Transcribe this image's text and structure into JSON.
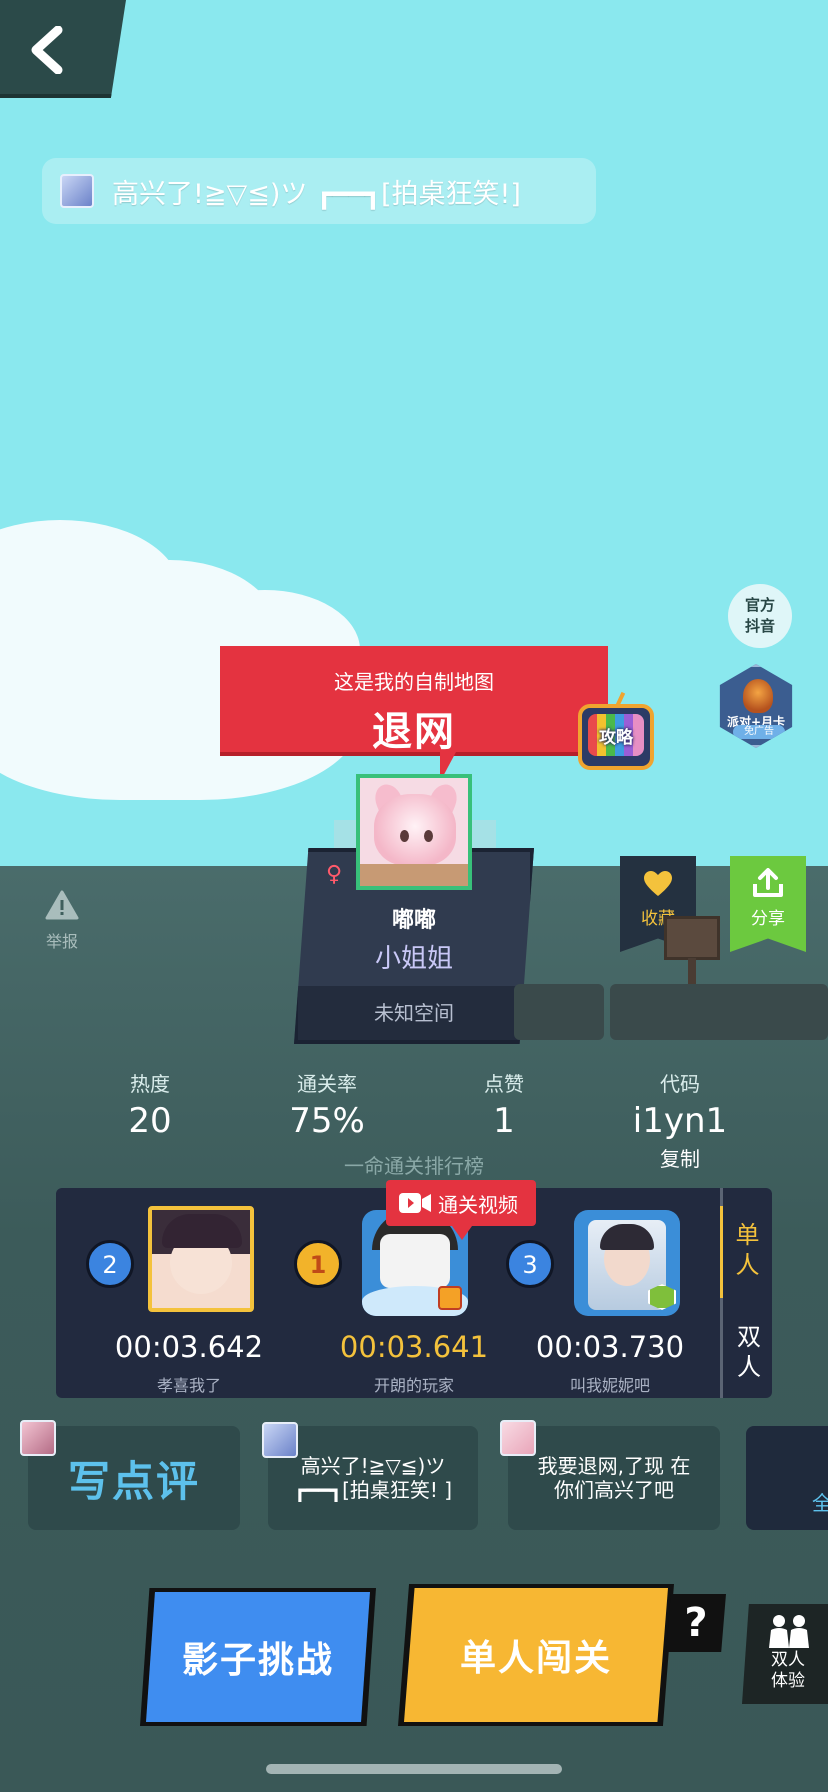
{
  "banner": {
    "text": "高兴了!≧▽≦)ツ ┏━━┓[拍桌狂笑!]"
  },
  "top_right": {
    "official_label": "官方\n抖音",
    "promo_label": "派对+月卡",
    "promo_sub": "免广告"
  },
  "map": {
    "subtitle": "这是我的自制地图",
    "title": "退网",
    "guide_label": "攻略"
  },
  "creator": {
    "gender": "♀",
    "name": "嘟嘟",
    "title": "小姐姐",
    "space": "未知空间"
  },
  "actions": {
    "report_label": "举报",
    "favorite_label": "收藏",
    "share_label": "分享"
  },
  "stats": {
    "heat": {
      "label": "热度",
      "value": "20"
    },
    "clear_rate": {
      "label": "通关率",
      "value": "75%"
    },
    "likes": {
      "label": "点赞",
      "value": "1"
    },
    "code": {
      "label": "代码",
      "value": "i1yn1",
      "copy_label": "复制"
    }
  },
  "leaderboard": {
    "title": "一命通关排行榜",
    "video_label": "通关视频",
    "tabs": [
      "单人",
      "双人"
    ],
    "entries": [
      {
        "rank": "2",
        "time": "00:03.642",
        "name": "孝喜我了"
      },
      {
        "rank": "1",
        "time": "00:03.641",
        "name": "开朗的玩家"
      },
      {
        "rank": "3",
        "time": "00:03.730",
        "name": "叫我妮妮吧"
      }
    ]
  },
  "comments": {
    "write_label": "写点评",
    "items": [
      {
        "text": "高兴了!≧▽≦)ツ ┏━━┓[拍桌狂笑! ]"
      },
      {
        "text": "我要退网,了现 在你们高兴了吧"
      }
    ],
    "more_partial": "全"
  },
  "buttons": {
    "shadow_challenge": "影子挑战",
    "single_play": "单人闯关",
    "help": "?",
    "duo_label": "双人\n体验"
  },
  "colors": {
    "sky": "#8ae8ee",
    "ground": "#3f5f5d",
    "red": "#e43340",
    "gold": "#f4c23c",
    "blue_button": "#3f8df0",
    "yellow_button": "#f7b733",
    "green_share": "#6cc93f"
  }
}
